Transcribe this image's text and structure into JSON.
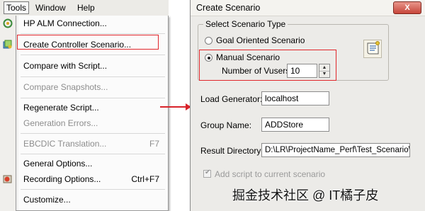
{
  "menubar": {
    "items": [
      {
        "label": "Tools",
        "underline": "T"
      },
      {
        "label": "Window",
        "underline": "W"
      },
      {
        "label": "Help",
        "underline": "H"
      }
    ]
  },
  "tools_menu": {
    "items": [
      {
        "label": "HP ALM Connection...",
        "enabled": true
      },
      {
        "label": "Create Controller Scenario...",
        "enabled": true,
        "highlighted": true
      },
      {
        "label": "Compare with Script...",
        "enabled": true
      },
      {
        "label": "Compare Snapshots...",
        "enabled": false
      },
      {
        "label": "Regenerate Script...",
        "enabled": true
      },
      {
        "label": "Generation Errors...",
        "enabled": false
      },
      {
        "label": "EBCDIC Translation...",
        "enabled": false,
        "shortcut": "F7"
      },
      {
        "label": "General Options...",
        "enabled": true
      },
      {
        "label": "Recording Options...",
        "enabled": true,
        "shortcut": "Ctrl+F7"
      },
      {
        "label": "Customize...",
        "enabled": true
      }
    ]
  },
  "dialog": {
    "title": "Create Scenario",
    "close_label": "X",
    "scenario_type": {
      "legend": "Select Scenario Type",
      "goal_label": "Goal Oriented Scenario",
      "manual_label": "Manual Scenario",
      "selected": "manual",
      "vusers_label": "Number of Vusers:",
      "vusers_value": "10"
    },
    "load_generator": {
      "label": "Load Generator:",
      "value": "localhost"
    },
    "group_name": {
      "label": "Group Name:",
      "value": "ADDStore"
    },
    "result_directory": {
      "label": "Result Directory:",
      "value": "D:\\LR\\ProjectName_Perf\\Test_Scenario\\A"
    },
    "add_script": {
      "label": "Add script to current scenario",
      "checked": true,
      "enabled": false
    }
  },
  "watermark": "掘金技术社区 @ IT橘子皮",
  "colors": {
    "highlight_red": "#e0262b",
    "arrow_red": "#d8232a"
  }
}
